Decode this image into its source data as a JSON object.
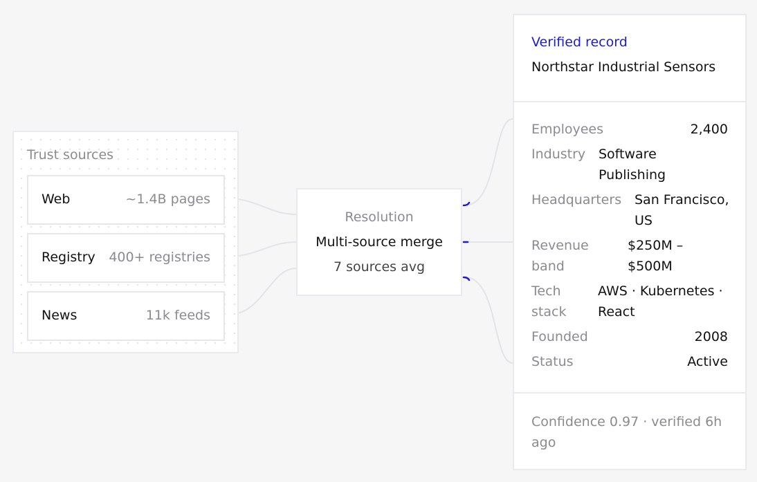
{
  "sources": {
    "title": "Trust sources",
    "items": [
      {
        "name": "Web",
        "metric": "~1.4B pages"
      },
      {
        "name": "Registry",
        "metric": "400+ registries"
      },
      {
        "name": "News",
        "metric": "11k feeds"
      }
    ]
  },
  "resolution": {
    "label": "Resolution",
    "method": "Multi-source merge",
    "detail": "7 sources avg"
  },
  "record": {
    "eyebrow": "Verified record",
    "name": "Northstar Industrial Sensors",
    "fields": [
      {
        "label": "Employees",
        "value": "2,400"
      },
      {
        "label": "Industry",
        "value": "Software Publishing"
      },
      {
        "label": "Headquarters",
        "value": "San Francisco, US"
      },
      {
        "label": "Revenue band",
        "value": "$250M – $500M"
      },
      {
        "label": "Tech stack",
        "value": "AWS · Kubernetes · React"
      },
      {
        "label": "Founded",
        "value": "2008"
      },
      {
        "label": "Status",
        "value": "Active"
      }
    ],
    "confidence": "Confidence 0.97 · verified 6h ago"
  },
  "colors": {
    "accent": "#1a1ad9",
    "muted": "#8a8a92",
    "border": "#e9e9f1"
  }
}
